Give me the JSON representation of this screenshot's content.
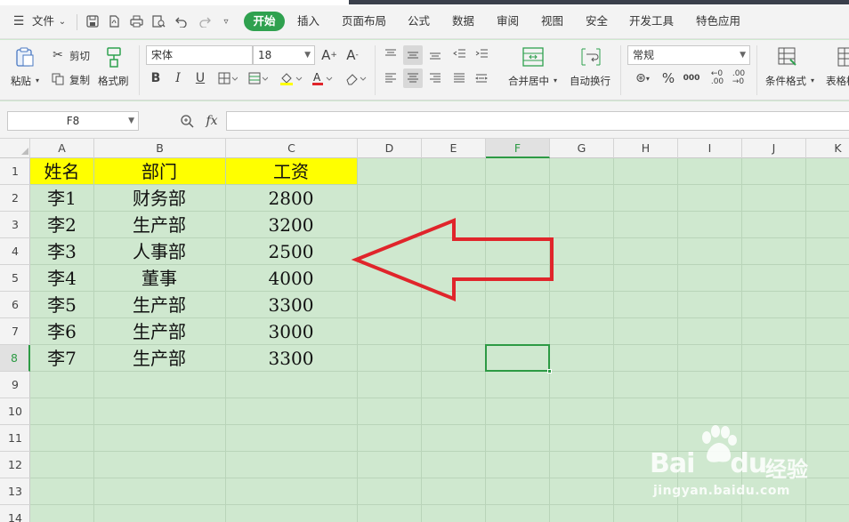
{
  "menu": {
    "file_label": "文件",
    "tabs": [
      "开始",
      "插入",
      "页面布局",
      "公式",
      "数据",
      "审阅",
      "视图",
      "安全",
      "开发工具",
      "特色应用"
    ],
    "active_tab": "开始"
  },
  "ribbon": {
    "paste_label": "粘贴",
    "cut_label": "剪切",
    "copy_label": "复制",
    "format_painter_label": "格式刷",
    "font_name": "宋体",
    "font_size": "18",
    "bold_glyph": "B",
    "italic_glyph": "I",
    "underline_glyph": "U",
    "merge_center_label": "合并居中",
    "wrap_text_label": "自动换行",
    "number_format": "常规",
    "percent_glyph": "%",
    "thousands_glyph": "000",
    "conditional_format_label": "条件格式",
    "table_style_label": "表格样"
  },
  "formula_bar": {
    "name_box": "F8",
    "fx_label": "fx",
    "content": ""
  },
  "columns": [
    "A",
    "B",
    "C",
    "D",
    "E",
    "F",
    "G",
    "H",
    "I",
    "J",
    "K"
  ],
  "rows": [
    "1",
    "2",
    "3",
    "4",
    "5",
    "6",
    "7",
    "8",
    "9",
    "10",
    "11",
    "12",
    "13",
    "14"
  ],
  "selected_cell": "F8",
  "table": {
    "headers": [
      "姓名",
      "部门",
      "工资"
    ],
    "rows": [
      [
        "李1",
        "财务部",
        "2800"
      ],
      [
        "李2",
        "生产部",
        "3200"
      ],
      [
        "李3",
        "人事部",
        "2500"
      ],
      [
        "李4",
        "董事",
        "4000"
      ],
      [
        "李5",
        "生产部",
        "3300"
      ],
      [
        "李6",
        "生产部",
        "3000"
      ],
      [
        "李7",
        "生产部",
        "3300"
      ]
    ]
  },
  "watermark": {
    "brand": "Bai",
    "brand_suffix": "du",
    "brand_cn": "经验",
    "url": "jingyan.baidu.com"
  },
  "colors": {
    "accent": "#2fa14f",
    "grid_bg": "#cfe8cf",
    "header_fill": "#ffff00",
    "arrow": "#e0252b"
  }
}
